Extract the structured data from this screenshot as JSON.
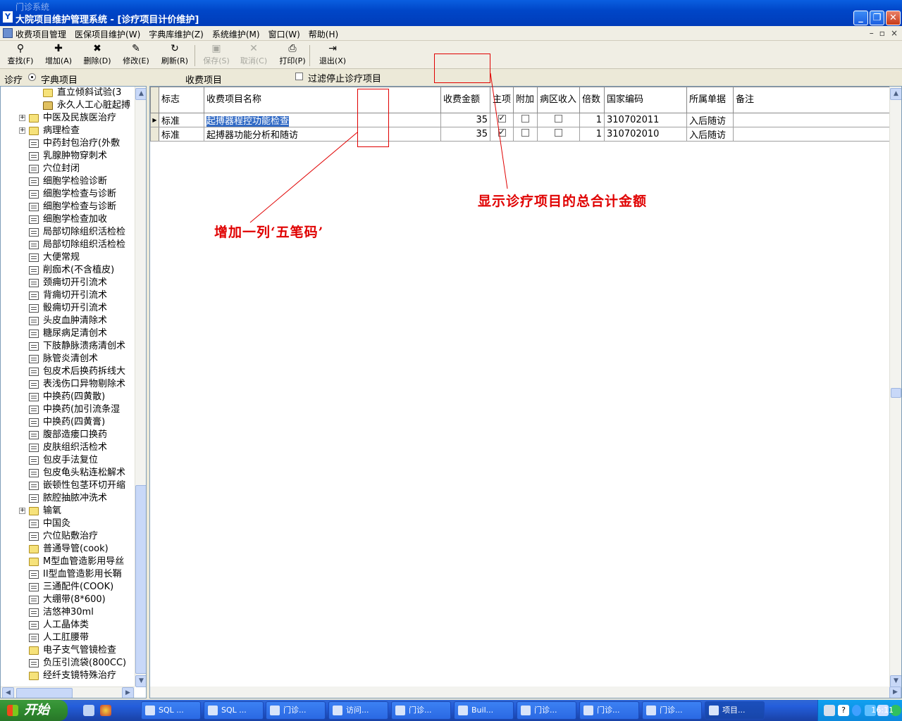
{
  "window": {
    "ghost_title": "门诊系统",
    "title": "大院项目维护管理系统 - [诊疗项目计价维护]",
    "app_icon_char": "Y"
  },
  "menu": {
    "items": [
      "收费项目管理",
      "医保项目维护(W)",
      "字典库维护(Z)",
      "系统维护(M)",
      "窗口(W)",
      "帮助(H)"
    ],
    "mdi_controls": [
      "–",
      "▫",
      "×"
    ]
  },
  "toolbar": {
    "buttons": [
      {
        "icon": "binoculars-icon",
        "glyph": "⚲",
        "label": "查找(F)",
        "enabled": true
      },
      {
        "icon": "add-icon",
        "glyph": "✚",
        "label": "增加(A)",
        "enabled": true
      },
      {
        "icon": "delete-icon",
        "glyph": "✖",
        "label": "删除(D)",
        "enabled": true
      },
      {
        "icon": "edit-icon",
        "glyph": "✎",
        "label": "修改(E)",
        "enabled": true
      },
      {
        "icon": "refresh-icon",
        "glyph": "↻",
        "label": "刷新(R)",
        "enabled": true
      },
      {
        "icon": "save-icon",
        "glyph": "▣",
        "label": "保存(S)",
        "enabled": false
      },
      {
        "icon": "cancel-icon",
        "glyph": "✕",
        "label": "取消(C)",
        "enabled": false
      },
      {
        "icon": "print-icon",
        "glyph": "⎙",
        "label": "打印(P)",
        "enabled": true
      },
      {
        "icon": "exit-icon",
        "glyph": "⇥",
        "label": "退出(X)",
        "enabled": true
      }
    ]
  },
  "filter": {
    "left_label": "诊疗",
    "radio_label": "字典项目",
    "section_label": "收费项目",
    "stop_filter_label": "过滤停止诊疗项目",
    "stop_filter_checked": false
  },
  "tree": {
    "items": [
      {
        "label": "直立倾斜试验(3",
        "type": "folder",
        "level": 2,
        "expander": false
      },
      {
        "label": "永久人工心脏起搏",
        "type": "special",
        "level": 2,
        "expander": false
      },
      {
        "label": "中医及民族医治疗",
        "type": "folder",
        "level": 1,
        "expander": true
      },
      {
        "label": "病理检查",
        "type": "folder",
        "level": 1,
        "expander": true
      },
      {
        "label": "中药封包治疗(外敷",
        "type": "doc",
        "level": 1,
        "expander": false
      },
      {
        "label": "乳腺肿物穿刺术",
        "type": "doc",
        "level": 1,
        "expander": false
      },
      {
        "label": "穴位封闭",
        "type": "doc",
        "level": 1,
        "expander": false
      },
      {
        "label": "细胞学检验诊断",
        "type": "doc",
        "level": 1,
        "expander": false
      },
      {
        "label": "细胞学检查与诊断",
        "type": "doc",
        "level": 1,
        "expander": false
      },
      {
        "label": "细胞学检查与诊断",
        "type": "doc",
        "level": 1,
        "expander": false
      },
      {
        "label": "细胞学检查加收",
        "type": "doc",
        "level": 1,
        "expander": false
      },
      {
        "label": "局部切除组织活检检",
        "type": "doc",
        "level": 1,
        "expander": false
      },
      {
        "label": "局部切除组织活检检",
        "type": "doc",
        "level": 1,
        "expander": false
      },
      {
        "label": "大便常规",
        "type": "doc",
        "level": 1,
        "expander": false
      },
      {
        "label": "削痂术(不含植皮)",
        "type": "doc",
        "level": 1,
        "expander": false
      },
      {
        "label": "颈痈切开引流术",
        "type": "doc",
        "level": 1,
        "expander": false
      },
      {
        "label": "背痈切开引流术",
        "type": "doc",
        "level": 1,
        "expander": false
      },
      {
        "label": "骰痈切开引流术",
        "type": "doc",
        "level": 1,
        "expander": false
      },
      {
        "label": "头皮血肿清除术",
        "type": "doc",
        "level": 1,
        "expander": false
      },
      {
        "label": "糖尿病足清创术",
        "type": "doc",
        "level": 1,
        "expander": false
      },
      {
        "label": "下肢静脉溃疡清创术",
        "type": "doc",
        "level": 1,
        "expander": false
      },
      {
        "label": "脉管炎清创术",
        "type": "doc",
        "level": 1,
        "expander": false
      },
      {
        "label": "包皮术后换药拆线大",
        "type": "doc",
        "level": 1,
        "expander": false
      },
      {
        "label": "表浅伤口异物剔除术",
        "type": "doc",
        "level": 1,
        "expander": false
      },
      {
        "label": "中换药(四黄散)",
        "type": "doc",
        "level": 1,
        "expander": false
      },
      {
        "label": "中换药(加引流条湿",
        "type": "doc",
        "level": 1,
        "expander": false
      },
      {
        "label": "中换药(四黄膏)",
        "type": "doc",
        "level": 1,
        "expander": false
      },
      {
        "label": "腹部造瘘口换药",
        "type": "doc",
        "level": 1,
        "expander": false
      },
      {
        "label": "皮肤组织活检术",
        "type": "doc",
        "level": 1,
        "expander": false
      },
      {
        "label": "包皮手法复位",
        "type": "doc",
        "level": 1,
        "expander": false
      },
      {
        "label": "包皮龟头粘连松解术",
        "type": "doc",
        "level": 1,
        "expander": false
      },
      {
        "label": "嵌顿性包茎环切开缩",
        "type": "doc",
        "level": 1,
        "expander": false
      },
      {
        "label": "脓腔抽脓冲洗术",
        "type": "doc",
        "level": 1,
        "expander": false
      },
      {
        "label": "输氧",
        "type": "folder",
        "level": 1,
        "expander": true
      },
      {
        "label": "中国灸",
        "type": "doc",
        "level": 1,
        "expander": false
      },
      {
        "label": "穴位贴敷治疗",
        "type": "doc",
        "level": 1,
        "expander": false
      },
      {
        "label": "普通导管(cook)",
        "type": "folder",
        "level": 1,
        "expander": false
      },
      {
        "label": "M型血管造影用导丝",
        "type": "folder",
        "level": 1,
        "expander": false
      },
      {
        "label": "II型血管造影用长鞘",
        "type": "doc",
        "level": 1,
        "expander": false
      },
      {
        "label": "三通配件(COOK)",
        "type": "doc",
        "level": 1,
        "expander": false
      },
      {
        "label": "大绷带(8*600)",
        "type": "doc",
        "level": 1,
        "expander": false
      },
      {
        "label": "洁悠神30ml",
        "type": "doc",
        "level": 1,
        "expander": false
      },
      {
        "label": "人工晶体类",
        "type": "doc",
        "level": 1,
        "expander": false
      },
      {
        "label": "人工肛腰带",
        "type": "doc",
        "level": 1,
        "expander": false
      },
      {
        "label": "电子支气管镜检查",
        "type": "folder",
        "level": 1,
        "expander": false
      },
      {
        "label": "负压引流袋(800CC)",
        "type": "doc",
        "level": 1,
        "expander": false
      },
      {
        "label": "经纤支镜特殊治疗",
        "type": "folder",
        "level": 1,
        "expander": false
      }
    ]
  },
  "grid": {
    "columns": [
      {
        "key": "flag",
        "label": "标志"
      },
      {
        "key": "name",
        "label": "收费项目名称"
      },
      {
        "key": "amount",
        "label": "收费金额"
      },
      {
        "key": "main",
        "label": "主项"
      },
      {
        "key": "extra",
        "label": "附加"
      },
      {
        "key": "ward",
        "label": "病区收入"
      },
      {
        "key": "multiple",
        "label": "倍数"
      },
      {
        "key": "code",
        "label": "国家编码"
      },
      {
        "key": "doc",
        "label": "所属单据"
      },
      {
        "key": "note",
        "label": "备注"
      }
    ],
    "rows": [
      {
        "flag": "标准",
        "name": "起搏器程控功能检查",
        "amount": "35",
        "main": true,
        "extra": false,
        "ward": false,
        "multiple": "1",
        "code": "310702011",
        "doc": "入后随访",
        "note": "",
        "current": true
      },
      {
        "flag": "标准",
        "name": "起搏器功能分析和随访",
        "amount": "35",
        "main": true,
        "extra": false,
        "ward": false,
        "multiple": "1",
        "code": "310702010",
        "doc": "入后随访",
        "note": "",
        "current": false
      }
    ]
  },
  "annotations": {
    "total_note": "显示诊疗项目的总合计金额",
    "wubi_note": "增加一列‘五笔码’",
    "color": "#e00000"
  },
  "taskbar": {
    "start_label": "开始",
    "tasks": [
      "SQL ...",
      "SQL ...",
      "门诊...",
      "访问...",
      "门诊...",
      "Buil...",
      "门诊...",
      "门诊...",
      "门诊...",
      "项目..."
    ],
    "active_index": 9,
    "clock": "16:11"
  }
}
